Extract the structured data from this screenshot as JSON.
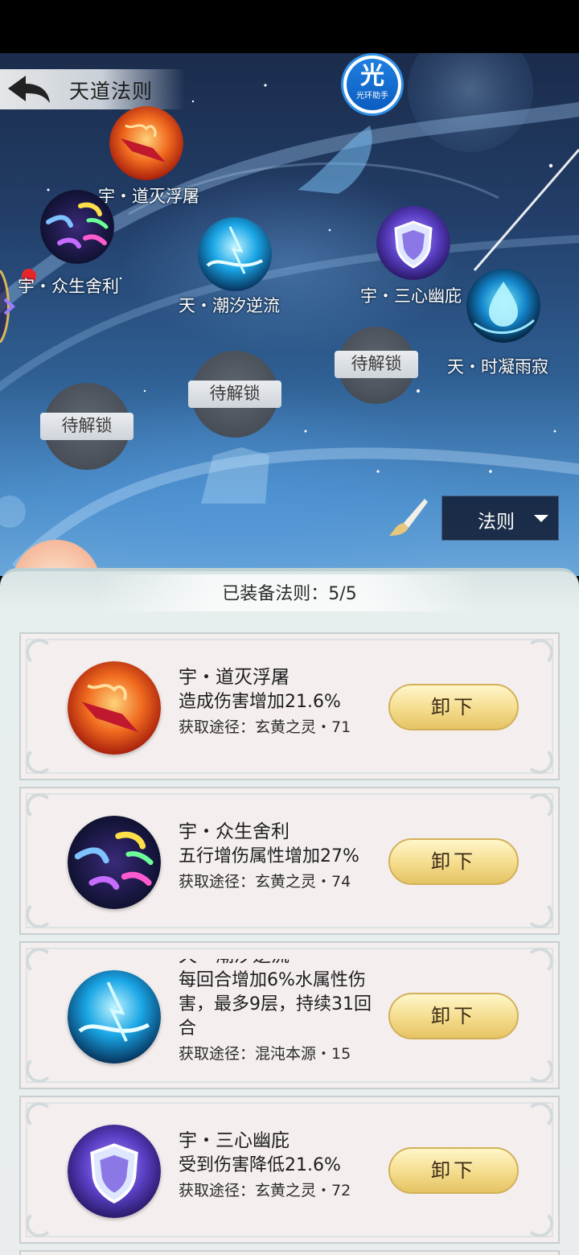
{
  "header": {
    "title": "天道法则",
    "helper_badge": {
      "char": "光",
      "label": "光环助手"
    }
  },
  "map": {
    "nodes": [
      {
        "label": "宇・道灭浮屠"
      },
      {
        "label": "宇・众生舍利"
      },
      {
        "label": "天・潮汐逆流"
      },
      {
        "label": "宇・三心幽庇"
      },
      {
        "label": "天・时凝雨寂"
      }
    ],
    "locked": [
      {
        "label": "待解锁"
      },
      {
        "label": "待解锁"
      },
      {
        "label": "待解锁"
      }
    ],
    "filter": {
      "label": "法则"
    }
  },
  "panel": {
    "equipped_count": "已装备法则：5/5",
    "cards": [
      {
        "name": "宇・道灭浮屠",
        "desc": "造成伤害增加21.6%",
        "source": "获取途径：玄黄之灵・71",
        "button": "卸下"
      },
      {
        "name": "宇・众生舍利",
        "desc": "五行增伤属性增加27%",
        "source": "获取途径：玄黄之灵・74",
        "button": "卸下"
      },
      {
        "name": "天・潮汐逆流",
        "desc": "每回合增加6%水属性伤害，最多9层，持续31回合",
        "source": "获取途径：混沌本源・15",
        "button": "卸下"
      },
      {
        "name": "宇・三心幽庇",
        "desc": "受到伤害降低21.6%",
        "source": "获取途径：玄黄之灵・72",
        "button": "卸下"
      }
    ]
  },
  "colors": {
    "accent_blue": "#2e8ee6",
    "button_gold": "#f4dc8c",
    "notification_red": "#e8262a"
  }
}
